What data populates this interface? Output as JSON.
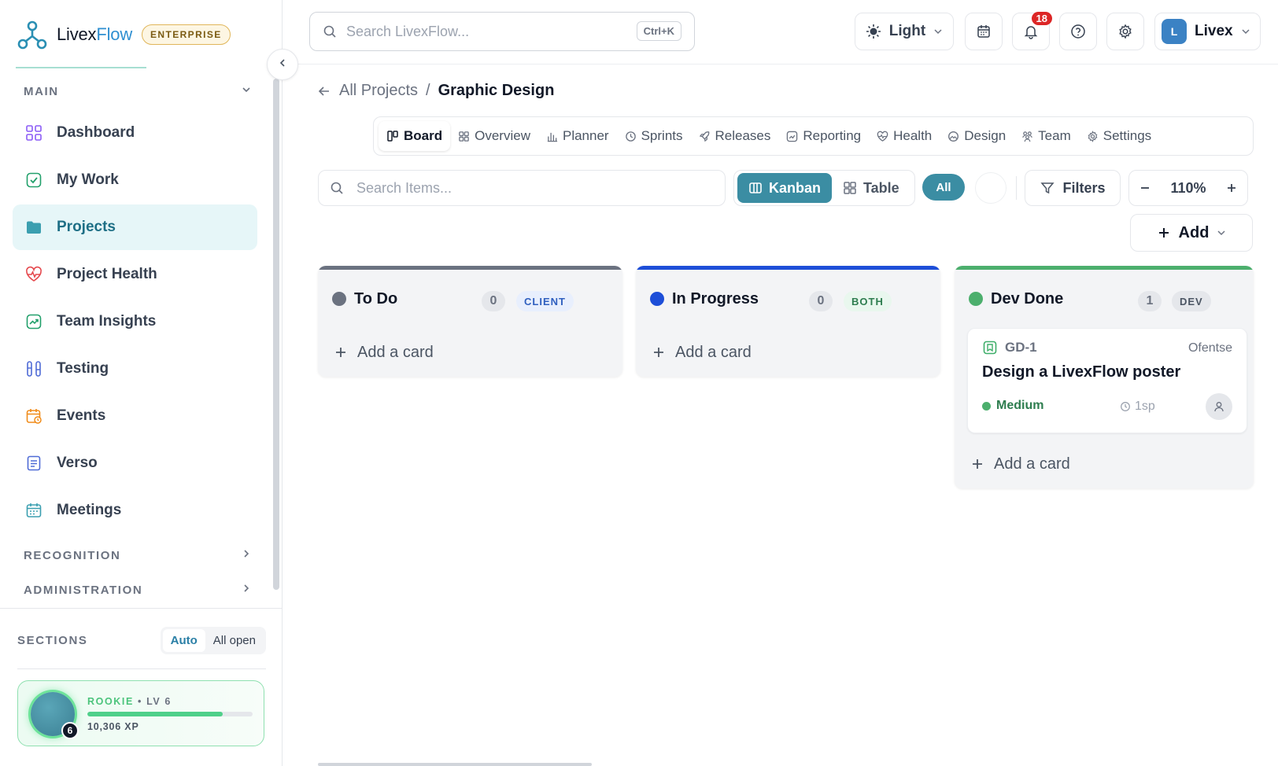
{
  "brand": {
    "name_a": "Livex",
    "name_b": "Flow",
    "badge": "ENTERPRISE"
  },
  "sidebar": {
    "main_label": "MAIN",
    "items": [
      {
        "label": "Dashboard",
        "icon": "dashboard-grid-icon"
      },
      {
        "label": "My Work",
        "icon": "check-square-icon"
      },
      {
        "label": "Projects",
        "icon": "folder-icon",
        "active": true
      },
      {
        "label": "Project Health",
        "icon": "heart-pulse-icon"
      },
      {
        "label": "Team Insights",
        "icon": "trend-chart-icon"
      },
      {
        "label": "Testing",
        "icon": "test-tubes-icon"
      },
      {
        "label": "Events",
        "icon": "calendar-clock-icon"
      },
      {
        "label": "Verso",
        "icon": "document-icon"
      },
      {
        "label": "Meetings",
        "icon": "calendar-icon"
      }
    ],
    "recognition_label": "RECOGNITION",
    "administration_label": "ADMINISTRATION",
    "sections_label": "SECTIONS",
    "sections_auto": "Auto",
    "sections_all_open": "All open",
    "xp": {
      "rank": "ROOKIE",
      "level": "LV 6",
      "xp_text": "10,306 XP",
      "level_num": "6",
      "progress": 0.82
    }
  },
  "topbar": {
    "search_placeholder": "Search LivexFlow...",
    "search_shortcut": "Ctrl+K",
    "theme_label": "Light",
    "notifications_count": "18",
    "user_initial": "L",
    "user_name": "Livex"
  },
  "breadcrumb": {
    "parent": "All Projects",
    "separator": "/",
    "current": "Graphic Design"
  },
  "tabs": [
    {
      "label": "Board",
      "icon": "board-icon",
      "active": true
    },
    {
      "label": "Overview",
      "icon": "grid-icon"
    },
    {
      "label": "Planner",
      "icon": "bar-chart-icon"
    },
    {
      "label": "Sprints",
      "icon": "clock-icon"
    },
    {
      "label": "Releases",
      "icon": "rocket-icon"
    },
    {
      "label": "Reporting",
      "icon": "line-chart-icon"
    },
    {
      "label": "Health",
      "icon": "heart-icon"
    },
    {
      "label": "Design",
      "icon": "image-icon"
    },
    {
      "label": "Team",
      "icon": "team-icon"
    },
    {
      "label": "Settings",
      "icon": "gear-icon"
    }
  ],
  "toolbar": {
    "search_placeholder": "Search Items...",
    "kanban_label": "Kanban",
    "table_label": "Table",
    "all_label": "All",
    "filters_label": "Filters",
    "zoom_value": "110%",
    "add_label": "Add"
  },
  "columns": [
    {
      "title": "To Do",
      "count": "0",
      "tag": "CLIENT",
      "color": "#6b7280",
      "tag_bg": "#e8effd",
      "tag_color": "#2f5fbf",
      "add_label": "Add a card",
      "cards": []
    },
    {
      "title": "In Progress",
      "count": "0",
      "tag": "BOTH",
      "color": "#1d4ed8",
      "tag_bg": "#e9f7ee",
      "tag_color": "#2e7d4f",
      "add_label": "Add a card",
      "cards": []
    },
    {
      "title": "Dev Done",
      "count": "1",
      "tag": "DEV",
      "color": "#4caf6d",
      "tag_bg": "#e5e7eb",
      "tag_color": "#4b5563",
      "add_label": "Add a card",
      "cards": [
        {
          "key": "GD-1",
          "owner": "Ofentse",
          "title": "Design a LivexFlow poster",
          "priority": "Medium",
          "points": "1sp"
        }
      ]
    }
  ]
}
